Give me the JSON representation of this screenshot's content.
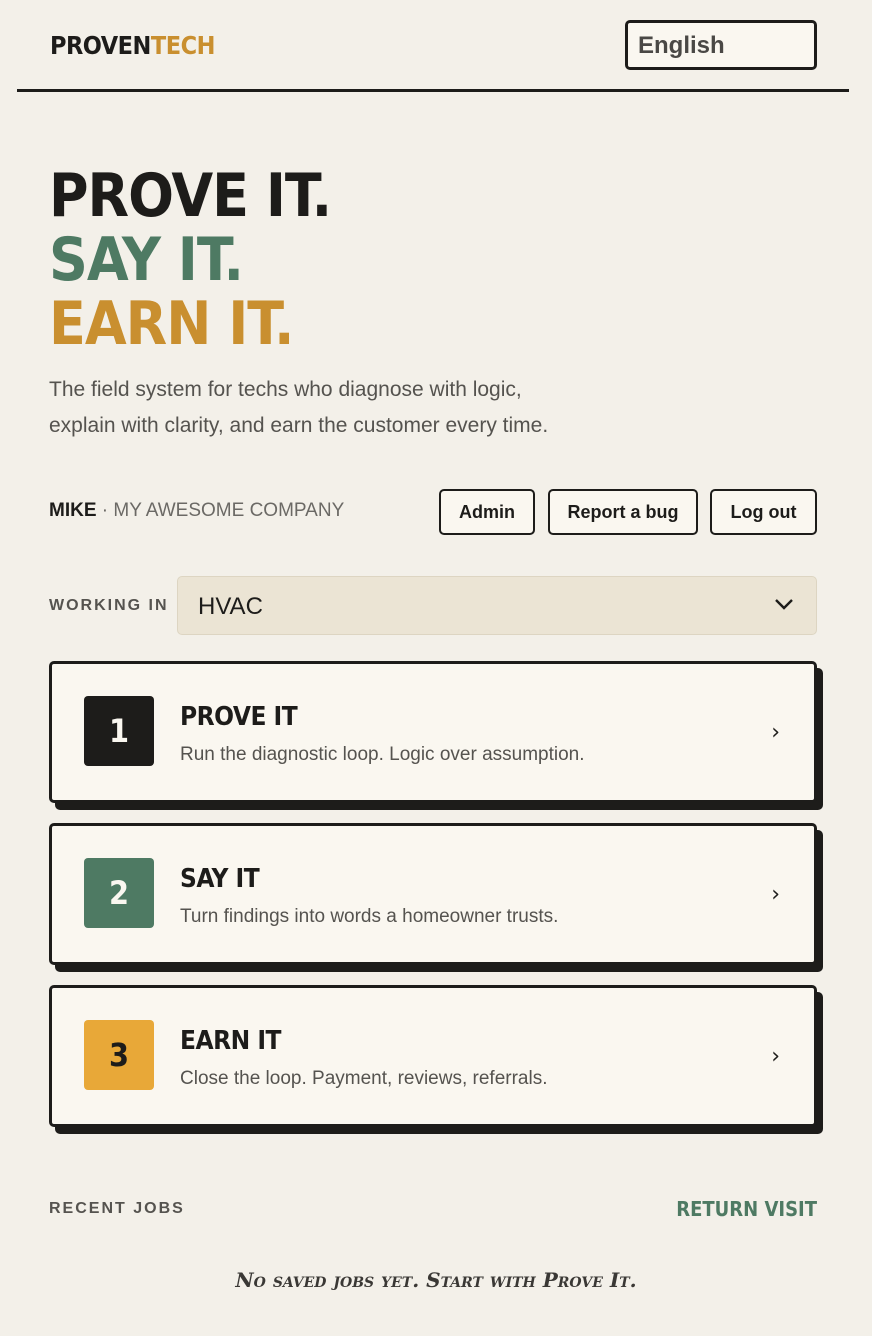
{
  "header": {
    "logo_part1": "PROVEN",
    "logo_part2": "TECH",
    "language": "English"
  },
  "hero": {
    "line1": "PROVE IT.",
    "line2": "SAY IT.",
    "line3": "EARN IT.",
    "tagline_line1": "The field system for techs who diagnose with logic,",
    "tagline_line2": "explain with clarity, and earn the customer every time."
  },
  "user": {
    "name": "MIKE",
    "separator": " · ",
    "company": "MY AWESOME COMPANY"
  },
  "actions": {
    "admin": "Admin",
    "report_bug": "Report a bug",
    "logout": "Log out"
  },
  "trade": {
    "label": "WORKING IN",
    "selected": "HVAC"
  },
  "steps": [
    {
      "number": "1",
      "title": "PROVE IT",
      "description": "Run the diagnostic loop. Logic over assumption.",
      "color": "#1d1c1a",
      "text_color": "#faf7f0"
    },
    {
      "number": "2",
      "title": "SAY IT",
      "description": "Turn findings into words a homeowner trusts.",
      "color": "#4e7a63",
      "text_color": "#faf7f0"
    },
    {
      "number": "3",
      "title": "EARN IT",
      "description": "Close the loop. Payment, reviews, referrals.",
      "color": "#e8a838",
      "text_color": "#1d1c1a"
    }
  ],
  "arrow_glyph": "›",
  "recent": {
    "label": "RECENT JOBS",
    "return_visit": "RETURN VISIT",
    "empty_message": "No saved jobs yet. Start with Prove It."
  },
  "colors": {
    "background": "#f3f0e9",
    "ink": "#1d1c1a",
    "green": "#4e7a63",
    "gold": "#c98f2f"
  }
}
